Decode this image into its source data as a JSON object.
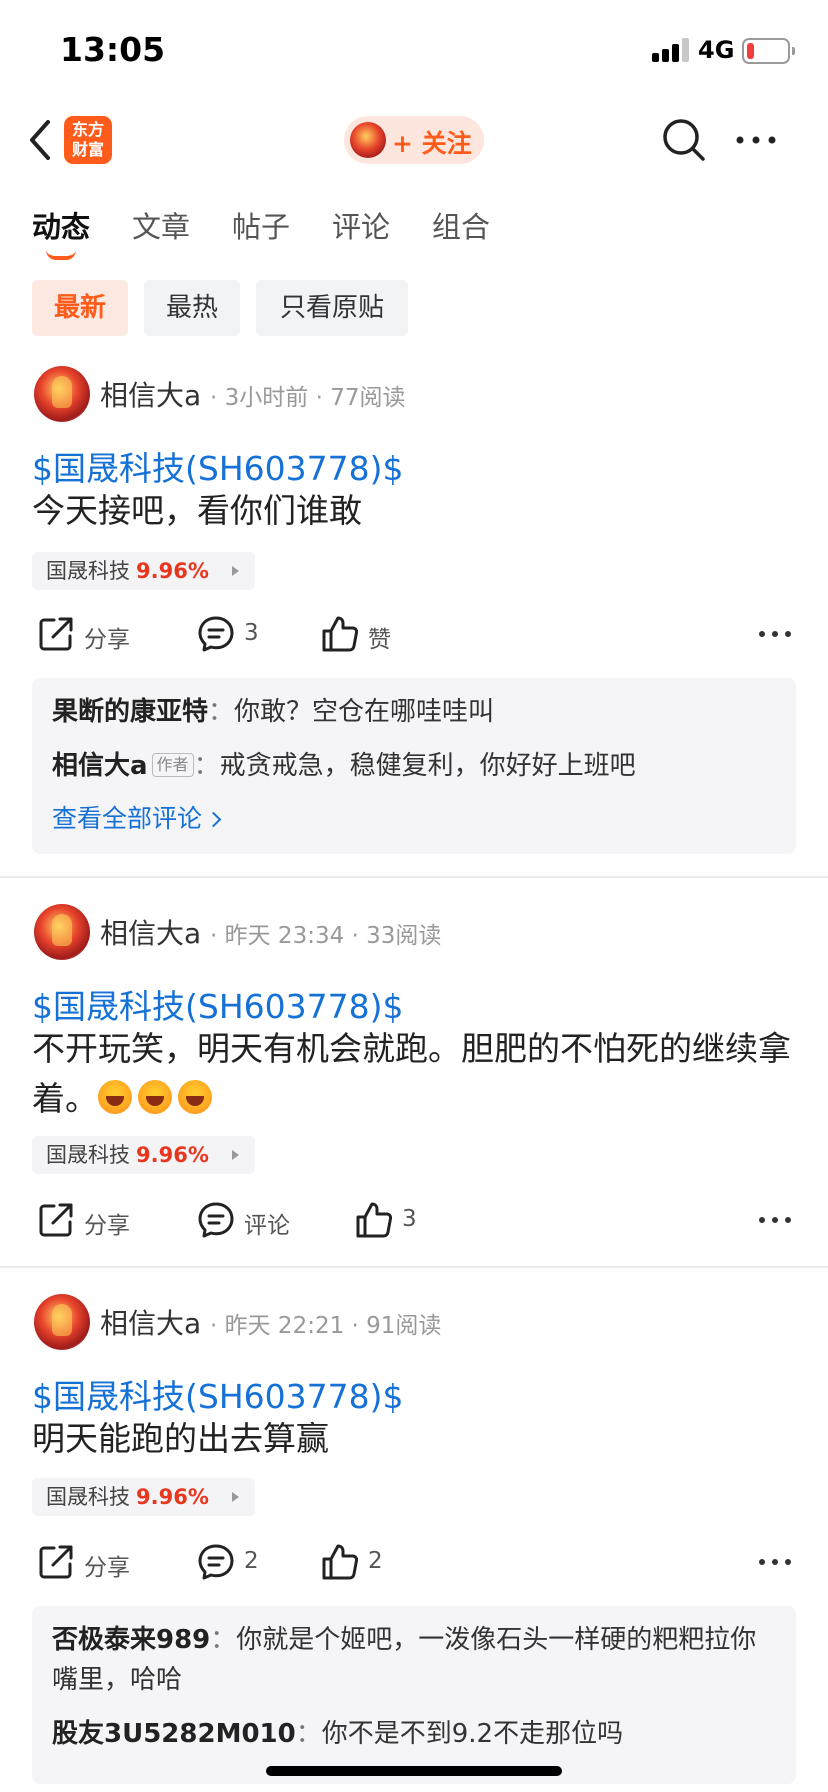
{
  "status_bar": {
    "time": "13:05",
    "network": "4G"
  },
  "header": {
    "app_logo_text": [
      "东方",
      "财富"
    ],
    "follow_label": "+ 关注"
  },
  "tabs": [
    {
      "label": "动态",
      "active": true
    },
    {
      "label": "文章",
      "active": false
    },
    {
      "label": "帖子",
      "active": false
    },
    {
      "label": "评论",
      "active": false
    },
    {
      "label": "组合",
      "active": false
    }
  ],
  "filters": [
    {
      "label": "最新",
      "active": true
    },
    {
      "label": "最热",
      "active": false
    },
    {
      "label": "只看原贴",
      "active": false
    }
  ],
  "posts": [
    {
      "author": "相信大a",
      "meta": "· 3小时前 · 77阅读",
      "stock_link": "$国晟科技(SH603778)$",
      "body": "今天接吧，看你们谁敢",
      "stock_tag": {
        "name": "国晟科技",
        "pct": "9.96%"
      },
      "actions": {
        "share": "分享",
        "comment": "3",
        "like": "赞"
      },
      "comments": [
        {
          "user": "果断的康亚特",
          "sep": "：",
          "text": "你敢？空仓在哪哇哇叫"
        },
        {
          "user": "相信大a",
          "badge": "作者",
          "sep": "：",
          "text": "戒贪戒急，稳健复利，你好好上班吧"
        }
      ],
      "view_all": "查看全部评论"
    },
    {
      "author": "相信大a",
      "meta": "· 昨天 23:34 · 33阅读",
      "stock_link": "$国晟科技(SH603778)$",
      "body": "不开玩笑，明天有机会就跑。胆肥的不怕死的继续拿着。",
      "emoji_count": 3,
      "stock_tag": {
        "name": "国晟科技",
        "pct": "9.96%"
      },
      "actions": {
        "share": "分享",
        "comment": "评论",
        "like": "3"
      }
    },
    {
      "author": "相信大a",
      "meta": "· 昨天 22:21 · 91阅读",
      "stock_link": "$国晟科技(SH603778)$",
      "body": "明天能跑的出去算赢",
      "stock_tag": {
        "name": "国晟科技",
        "pct": "9.96%"
      },
      "actions": {
        "share": "分享",
        "comment": "2",
        "like": "2"
      },
      "comments": [
        {
          "user": "否极泰来989",
          "sep": "：",
          "text": "你就是个姬吧，一泼像石头一样硬的粑粑拉你嘴里，哈哈"
        },
        {
          "user": "股友3U5282M010",
          "sep": "：",
          "text": "你不是不到9.2不走那位吗"
        }
      ]
    }
  ],
  "icons": {
    "back": "chevron-left-icon",
    "search": "search-icon",
    "more": "more-horizontal-icon",
    "share": "share-icon",
    "comment": "comment-icon",
    "like": "thumbs-up-icon"
  },
  "colors": {
    "accent": "#ff5b1a",
    "link": "#1671d6",
    "rise": "#e8361f"
  }
}
